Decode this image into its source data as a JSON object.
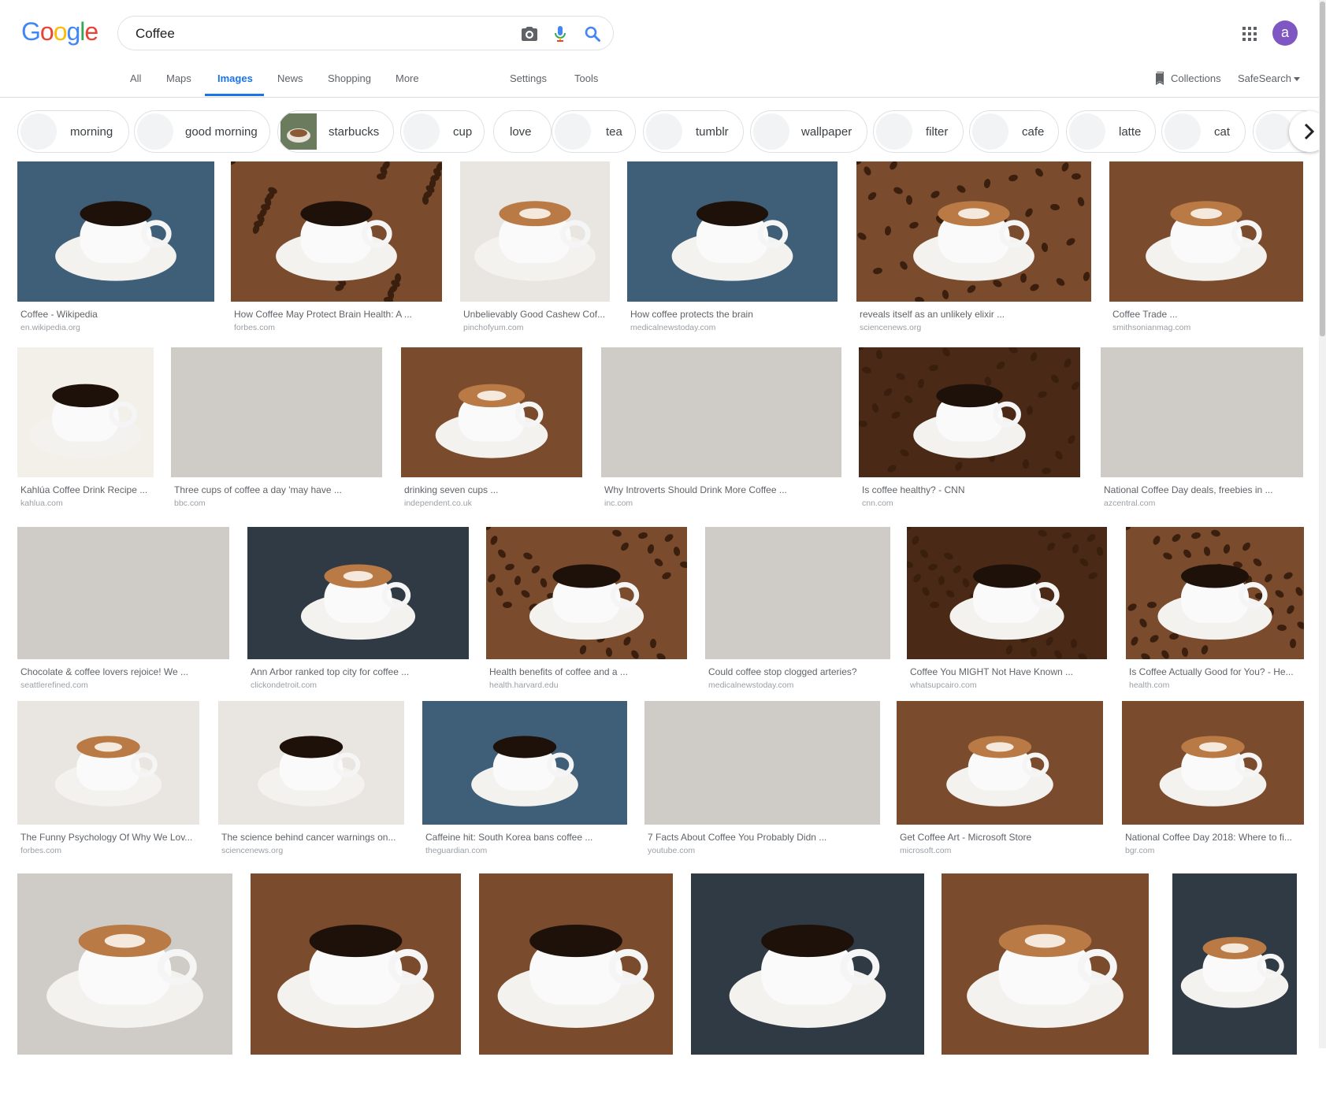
{
  "logo": "Google",
  "search": {
    "query": "Coffee"
  },
  "tabs": [
    "All",
    "Maps",
    "Images",
    "News",
    "Shopping",
    "More"
  ],
  "tools": {
    "settings": "Settings",
    "tools": "Tools"
  },
  "right": {
    "collections": "Collections",
    "safesearch": "SafeSearch"
  },
  "avatar_letter": "a",
  "colors": {
    "accent": "#1a73e8",
    "avatar": "#7e57c2"
  },
  "chips": [
    "morning",
    "good morning",
    "starbucks",
    "cup",
    "love",
    "tea",
    "tumblr",
    "wallpaper",
    "filter",
    "cafe",
    "latte",
    "cat"
  ],
  "results": [
    [
      {
        "title": "Coffee - Wikipedia",
        "source": "en.wikipedia.org"
      },
      {
        "title": "How Coffee May Protect Brain Health: A ...",
        "source": "forbes.com"
      },
      {
        "title": "Unbelievably Good Cashew Cof...",
        "source": "pinchofyum.com"
      },
      {
        "title": "How coffee protects the brain",
        "source": "medicalnewstoday.com"
      },
      {
        "title": "reveals itself as an unlikely elixir ...",
        "source": "sciencenews.org"
      },
      {
        "title": "Coffee Trade ...",
        "source": "smithsonianmag.com"
      }
    ],
    [
      {
        "title": "Kahlúa Coffee Drink Recipe ...",
        "source": "kahlua.com"
      },
      {
        "title": "Three cups of coffee a day 'may have ...",
        "source": "bbc.com"
      },
      {
        "title": "drinking seven cups ...",
        "source": "independent.co.uk"
      },
      {
        "title": "Why Introverts Should Drink More Coffee ...",
        "source": "inc.com"
      },
      {
        "title": "Is coffee healthy? - CNN",
        "source": "cnn.com"
      },
      {
        "title": "National Coffee Day deals, freebies in ...",
        "source": "azcentral.com"
      }
    ],
    [
      {
        "title": "Chocolate & coffee lovers rejoice! We ...",
        "source": "seattlerefined.com"
      },
      {
        "title": "Ann Arbor ranked top city for coffee ...",
        "source": "clickondetroit.com"
      },
      {
        "title": "Health benefits of coffee and a ...",
        "source": "health.harvard.edu"
      },
      {
        "title": "Could coffee stop clogged arteries?",
        "source": "medicalnewstoday.com"
      },
      {
        "title": "Coffee You MIGHT Not Have Known ...",
        "source": "whatsupcairo.com"
      },
      {
        "title": "Is Coffee Actually Good for You? - He...",
        "source": "health.com"
      }
    ],
    [
      {
        "title": "The Funny Psychology Of Why We Lov...",
        "source": "forbes.com"
      },
      {
        "title": "The science behind cancer warnings on...",
        "source": "sciencenews.org"
      },
      {
        "title": "Caffeine hit: South Korea bans coffee ...",
        "source": "theguardian.com"
      },
      {
        "title": "7 Facts About Coffee You Probably Didn ...",
        "source": "youtube.com"
      },
      {
        "title": "Get Coffee Art - Microsoft Store",
        "source": "microsoft.com"
      },
      {
        "title": "National Coffee Day 2018: Where to fi...",
        "source": "bgr.com"
      }
    ],
    [
      {
        "title": "",
        "source": ""
      },
      {
        "title": "",
        "source": ""
      },
      {
        "title": "",
        "source": ""
      },
      {
        "title": "",
        "source": ""
      },
      {
        "title": "",
        "source": ""
      },
      {
        "title": "",
        "source": ""
      }
    ]
  ]
}
